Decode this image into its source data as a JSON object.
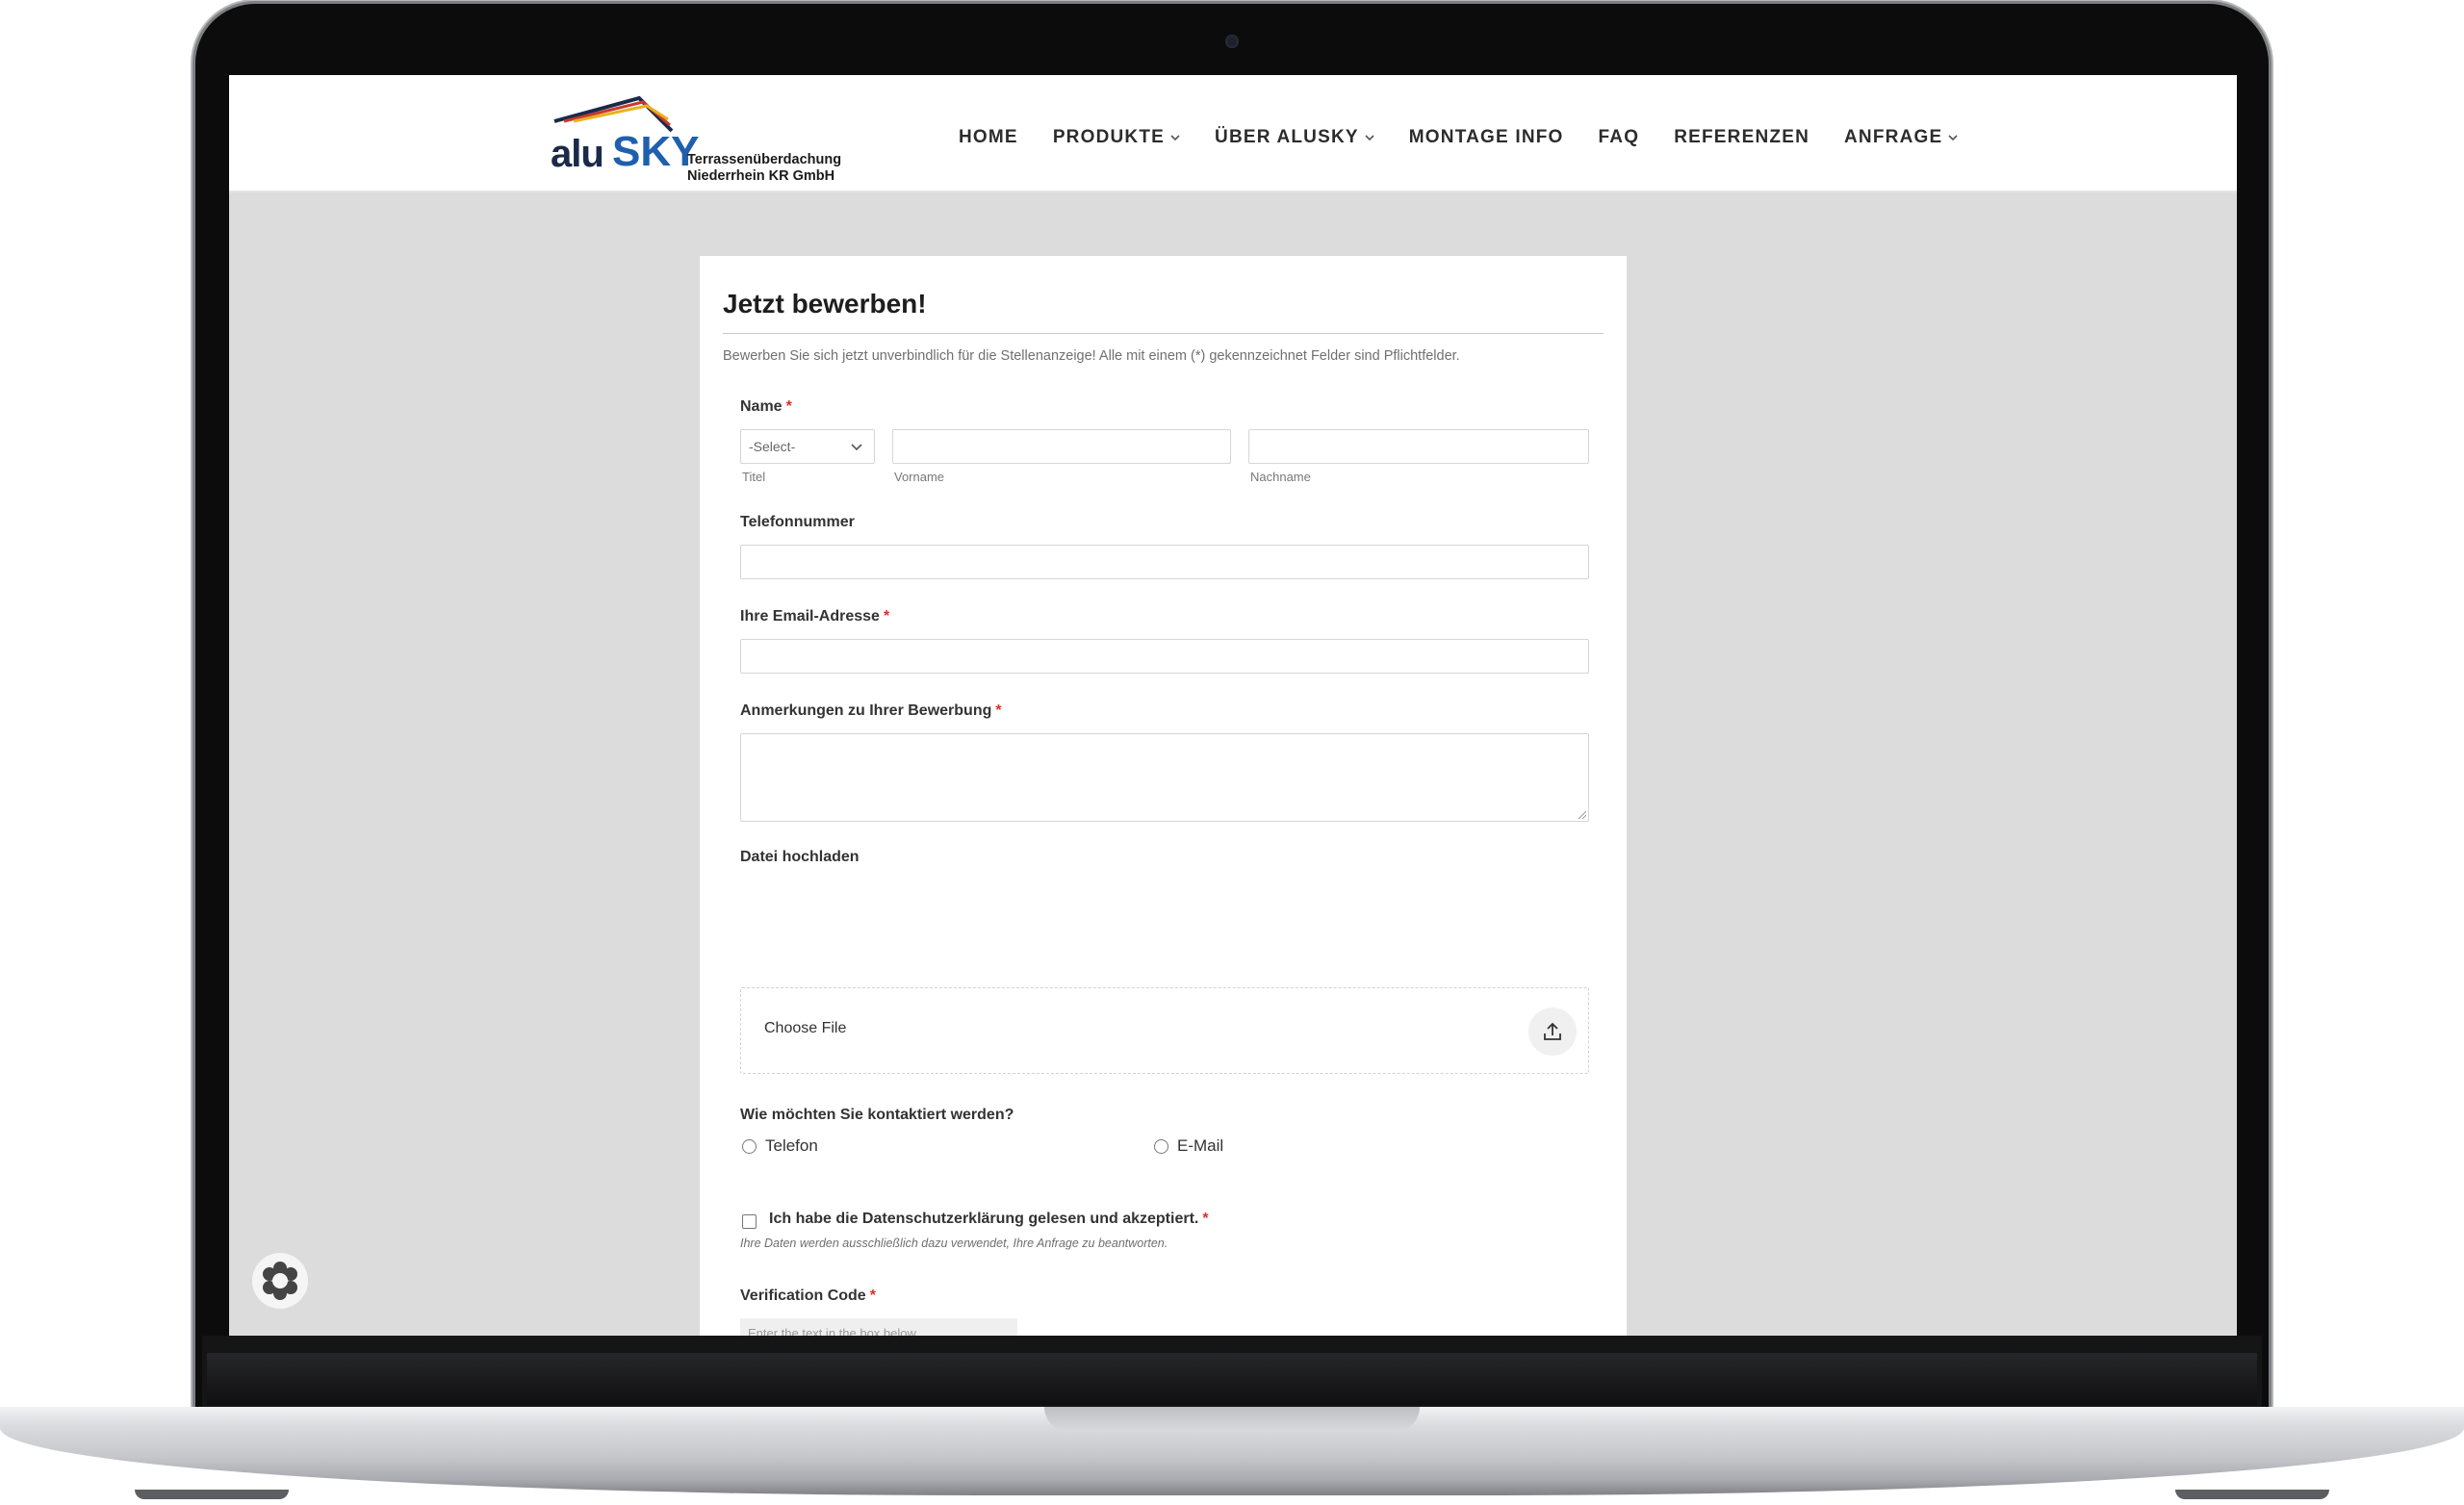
{
  "brand": {
    "logo_alu": "alu",
    "logo_sky": "SKY",
    "tagline_line1": "Terrassenüberdachung",
    "tagline_line2": "Niederrhein KR GmbH"
  },
  "nav": {
    "items": [
      {
        "label": "HOME",
        "has_dropdown": false
      },
      {
        "label": "PRODUKTE",
        "has_dropdown": true
      },
      {
        "label": "ÜBER ALUSKY",
        "has_dropdown": true
      },
      {
        "label": "MONTAGE INFO",
        "has_dropdown": false
      },
      {
        "label": "FAQ",
        "has_dropdown": false
      },
      {
        "label": "REFERENZEN",
        "has_dropdown": false
      },
      {
        "label": "ANFRAGE",
        "has_dropdown": true
      }
    ],
    "chevron": "⌵"
  },
  "form": {
    "title": "Jetzt bewerben!",
    "intro": "Bewerben Sie sich jetzt unverbindlich für die Stellenanzeige! Alle mit einem (*) gekennzeichnet Felder sind Pflichtfelder.",
    "required_mark": "*",
    "name": {
      "label": "Name",
      "title_select_value": "-Select-",
      "title_sublabel": "Titel",
      "first_sublabel": "Vorname",
      "last_sublabel": "Nachname"
    },
    "phone": {
      "label": "Telefonnummer",
      "value": ""
    },
    "email": {
      "label": "Ihre Email-Adresse",
      "value": ""
    },
    "notes": {
      "label": "Anmerkungen zu Ihrer Bewerbung",
      "value": ""
    },
    "upload": {
      "label": "Datei hochladen",
      "button_text": "Choose File"
    },
    "contact_method": {
      "label": "Wie möchten Sie kontaktiert werden?",
      "options": [
        "Telefon",
        "E-Mail"
      ],
      "selected": null
    },
    "consent": {
      "label": "Ich habe die Datenschutzerklärung gelesen und akzeptiert.",
      "note": "Ihre Daten werden ausschließlich dazu verwendet, Ihre Anfrage zu beantworten.",
      "checked": false
    },
    "captcha": {
      "label": "Verification Code",
      "hint": "Enter the text in the box below",
      "refresh_icon": "⟳"
    }
  },
  "colors": {
    "accent_required": "#d9312b",
    "logo_navy": "#1b2a4a",
    "logo_blue": "#1f5fae",
    "roof_red": "#c8392b",
    "roof_yellow": "#e9b21e",
    "page_bg": "#dcdcdc"
  }
}
